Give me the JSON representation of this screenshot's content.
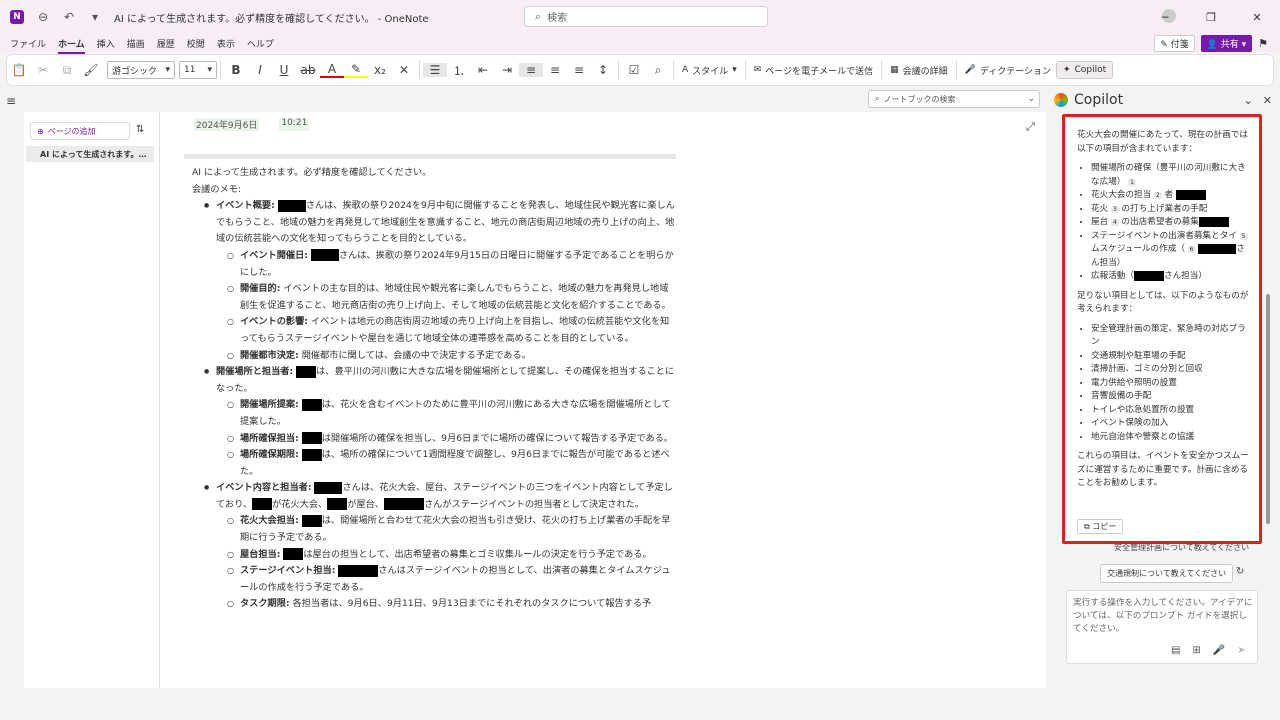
{
  "titlebar": {
    "app_icon": "N",
    "title": "AI によって生成されます。必ず精度を確認してください。 - OneNote",
    "search_placeholder": "検索",
    "icons": {
      "back": "back-icon",
      "undo": "undo-icon",
      "quick": "customize-icon"
    }
  },
  "menu": {
    "items": [
      "ファイル",
      "ホーム",
      "挿入",
      "描画",
      "履歴",
      "校閲",
      "表示",
      "ヘルプ"
    ],
    "note_label": "付箋",
    "share_label": "共有"
  },
  "ribbon": {
    "font_name": "游ゴシック",
    "font_size": "11",
    "style_label": "スタイル",
    "email_label": "ページを電子メールで送信",
    "meeting_label": "会議の詳細",
    "dictation_label": "ディクテーション",
    "copilot_label": "Copilot"
  },
  "pages": {
    "add_label": "ページの追加",
    "item": "AI によって生成されます。…"
  },
  "canvas": {
    "date": "2024年9月6日",
    "time": "10:21",
    "header": "AI によって生成されます。必ず精度を確認してください。",
    "meeting_memo": "会議のメモ:",
    "b1_label": "イベント概要:",
    "b1_text": "さんは、挨歌の祭り2024を9月中旬に開催することを発表し、地域住民や観光客に楽しんでもらうこと、地域の魅力を再発見して地域創生を意識すること、地元の商店街周辺地域の売り上げの向上、地域の伝統芸能への文化を知ってもらうことを目的としている。",
    "b1a_label": "イベント開催日:",
    "b1a_text": "さんは、挨歌の祭り2024年9月15日の日曜日に開催する予定であることを明らかにした。",
    "b1b_label": "開催目的:",
    "b1b_text": "イベントの主な目的は、地域住民や観光客に楽しんでもらうこと、地域の魅力を再発見し地域創生を促進すること、地元商店街の売り上げ向上、そして地域の伝統芸能と文化を紹介することである。",
    "b1c_label": "イベントの影響:",
    "b1c_text": "イベントは地元の商店街周辺地域の売り上げ向上を目指し、地域の伝統芸能や文化を知ってもらうステージイベントや屋台を通じて地域全体の連帯感を高めることを目的としている。",
    "b1d_label": "開催都市決定:",
    "b1d_text": "開催都市に関しては、会議の中で決定する予定である。",
    "b2_label": "開催場所と担当者:",
    "b2_text": "は、豊平川の河川敷に大きな広場を開催場所として提案し、その確保を担当することになった。",
    "b2a_label": "開催場所提案:",
    "b2a_text": "は、花火を含むイベントのために豊平川の河川敷にある大きな広場を開催場所として提案した。",
    "b2b_label": "場所確保担当:",
    "b2b_text": "は開催場所の確保を担当し、9月6日までに場所の確保について報告する予定である。",
    "b2c_label": "場所確保期限:",
    "b2c_text": "は、場所の確保について1週間程度で調整し、9月6日までに報告が可能であると述べた。",
    "b3_label": "イベント内容と担当者:",
    "b3_text_1": "さんは、花火大会、屋台、ステージイベントの三つをイベント内容として予定しており、",
    "b3_text_2": "が花火大会、",
    "b3_text_3": "が屋台、",
    "b3_text_4": "さんがステージイベントの担当者として決定された。",
    "b3a_label": "花火大会担当:",
    "b3a_text": "は、開催場所と合わせて花火大会の担当も引き受け、花火の打ち上げ業者の手配を早期に行う予定である。",
    "b3b_label": "屋台担当:",
    "b3b_text": "は屋台の担当として、出店希望者の募集とゴミ収集ルールの決定を行う予定である。",
    "b3c_label": "ステージイベント担当:",
    "b3c_text": "さんはステージイベントの担当として、出演者の募集とタイムスケジュールの作成を行う予定である。",
    "b3d_label": "タスク期限:",
    "b3d_text": "各担当者は、9月6日、9月11日、9月13日までにそれぞれのタスクについて報告する予"
  },
  "notebook_search": {
    "placeholder": "ノートブックの検索"
  },
  "copilot": {
    "title": "Copilot",
    "intro": "花火大会の開催にあたって、現在の計画では以下の項目が含まれています：",
    "items1": [
      {
        "text": "開催場所の確保（豊平川の河川敷に大きな広場）",
        "ref": "1"
      },
      {
        "text": "花火大会の担当",
        "ref": "2",
        "suffix": "者"
      },
      {
        "text": "花火",
        "ref": "3",
        "suffix": "の打ち上げ業者の手配"
      },
      {
        "text": "屋台",
        "ref": "4",
        "suffix": "の出店希望者の募集"
      },
      {
        "text": "ステージイベントの出演者募集とタイ",
        "ref": "5",
        "suffix": "ムスケジュールの作成（",
        "ref2": "6",
        "suffix2": "さん担当）"
      },
      {
        "text": "広報活動（",
        "suffix": "さん担当）"
      }
    ],
    "missing_intro": "足りない項目としては、以下のようなものが考えられます：",
    "items2": [
      "安全管理計画の策定、緊急時の対応プラン",
      "交通規制や駐車場の手配",
      "清掃計画、ゴミの分別と回収",
      "電力供給や照明の設置",
      "音響設備の手配",
      "トイレや応急処置所の設置",
      "イベント保険の加入",
      "地元自治体や警察との協議"
    ],
    "closing": "これらの項目は、イベントを安全かつスムーズに運営するために重要です。計画に含めることをお勧めします。",
    "copy_label": "コピー",
    "suggestion1": "安全管理計画について教えてください",
    "suggestion2": "交通規制について教えてください",
    "input_placeholder": "実行する操作を入力してください。アイデアについては、以下のプロンプト ガイドを選択してください。"
  },
  "colors": {
    "accent": "#7719aa",
    "highlight_border": "#e0201e"
  }
}
